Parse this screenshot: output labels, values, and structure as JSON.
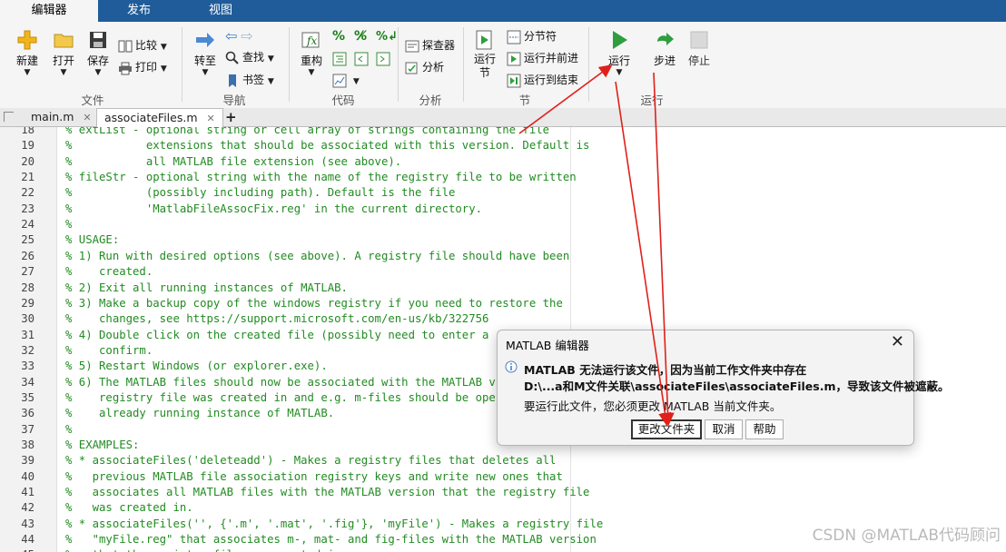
{
  "ribbon_tabs": [
    "编辑器",
    "发布",
    "视图"
  ],
  "toolbar": {
    "new": "新建",
    "open": "打开",
    "save": "保存",
    "compare": "比较",
    "print": "打印",
    "goto": "转至",
    "find": "查找",
    "bookmark": "书签",
    "refactor": "重构",
    "explorer": "探查器",
    "analyze": "分析",
    "run_section": "运行节",
    "section_break": "分节符",
    "run_and_advance": "运行并前进",
    "run_to_end": "运行到结束",
    "run": "运行",
    "step": "步进",
    "stop": "停止"
  },
  "groups": {
    "file": "文件",
    "navigate": "导航",
    "code": "代码",
    "analyze": "分析",
    "section": "节",
    "run": "运行"
  },
  "file_tabs": [
    "main.m",
    "associateFiles.m"
  ],
  "file_tab_add": "+",
  "code_lines": [
    {
      "n": "18",
      "t": "% extList - optional string or cell array of strings containing the file"
    },
    {
      "n": "19",
      "t": "%           extensions that should be associated with this version. Default is"
    },
    {
      "n": "20",
      "t": "%           all MATLAB file extension (see above)."
    },
    {
      "n": "21",
      "t": "% fileStr - optional string with the name of the registry file to be written"
    },
    {
      "n": "22",
      "t": "%           (possibly including path). Default is the file"
    },
    {
      "n": "23",
      "t": "%           'MatlabFileAssocFix.reg' in the current directory."
    },
    {
      "n": "24",
      "t": "%"
    },
    {
      "n": "25",
      "t": "% USAGE:"
    },
    {
      "n": "26",
      "t": "% 1) Run with desired options (see above). A registry file should have been"
    },
    {
      "n": "27",
      "t": "%    created."
    },
    {
      "n": "28",
      "t": "% 2) Exit all running instances of MATLAB."
    },
    {
      "n": "29",
      "t": "% 3) Make a backup copy of the windows registry if you need to restore the"
    },
    {
      "n": "30",
      "t": "%    changes, see https://support.microsoft.com/en-us/kb/322756"
    },
    {
      "n": "31",
      "t": "% 4) Double click on the created file (possibly need to enter a"
    },
    {
      "n": "32",
      "t": "%    confirm."
    },
    {
      "n": "33",
      "t": "% 5) Restart Windows (or explorer.exe)."
    },
    {
      "n": "34",
      "t": "% 6) The MATLAB files should now be associated with the MATLAB v"
    },
    {
      "n": "35",
      "t": "%    registry file was created in and e.g. m-files should be ope"
    },
    {
      "n": "36",
      "t": "%    already running instance of MATLAB."
    },
    {
      "n": "37",
      "t": "%"
    },
    {
      "n": "38",
      "t": "% EXAMPLES:"
    },
    {
      "n": "39",
      "t": "% * associateFiles('deleteadd') - Makes a registry files that deletes all"
    },
    {
      "n": "40",
      "t": "%   previous MATLAB file association registry keys and write new ones that"
    },
    {
      "n": "41",
      "t": "%   associates all MATLAB files with the MATLAB version that the registry file"
    },
    {
      "n": "42",
      "t": "%   was created in."
    },
    {
      "n": "43",
      "t": "% * associateFiles('', {'.m', '.mat', '.fig'}, 'myFile') - Makes a registry file"
    },
    {
      "n": "44",
      "t": "%   \"myFile.reg\" that associates m-, mat- and fig-files with the MATLAB version"
    },
    {
      "n": "45",
      "t": "%   that the registry file was created in."
    }
  ],
  "dialog": {
    "title": "MATLAB 编辑器",
    "close": "✕",
    "message_line1": "MATLAB 无法运行该文件，因为当前工作文件夹中存在",
    "message_line2": "D:\\...a和M文件关联\\associateFiles\\associateFiles.m，导致该文件被遮蔽。",
    "message_line3": "要运行此文件，您必须更改 MATLAB 当前文件夹。",
    "btn_change": "更改文件夹",
    "btn_cancel": "取消",
    "btn_help": "帮助"
  },
  "watermark": "CSDN @MATLAB代码顾问",
  "colors": {
    "ribbon_tab_bar": "#1f5c99",
    "comment_green": "#228b22",
    "run_green": "#2e9e3e",
    "annotation_red": "#e0201b"
  }
}
